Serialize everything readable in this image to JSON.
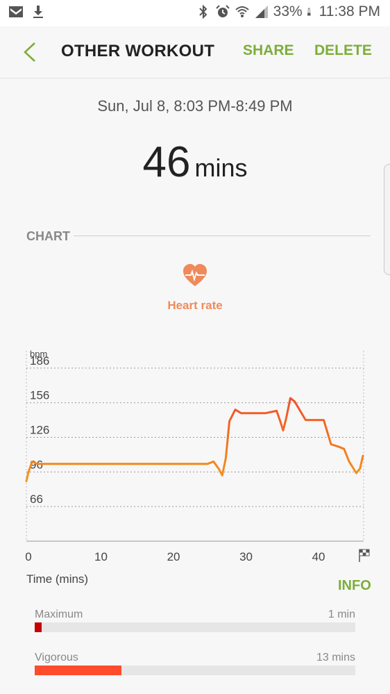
{
  "status_bar": {
    "battery": "33%",
    "time": "11:38 PM"
  },
  "header": {
    "title": "OTHER WORKOUT",
    "share_label": "SHARE",
    "delete_label": "DELETE"
  },
  "workout": {
    "date_range": "Sun, Jul 8, 8:03 PM-8:49 PM",
    "duration_value": "46",
    "duration_unit": "mins"
  },
  "section": {
    "label": "CHART",
    "metric_label": "Heart rate",
    "metric_color": "#f08a5a"
  },
  "chart_data": {
    "type": "line",
    "ylabel": "bpm",
    "xlabel": "Time (mins)",
    "y_ticks": [
      186,
      156,
      126,
      96,
      66
    ],
    "x_ticks": [
      0,
      10,
      20,
      30,
      40
    ],
    "xlim": [
      0,
      46.5
    ],
    "ylim": [
      36,
      201
    ],
    "grid": true,
    "line_color_low": "#f39a1b",
    "line_color_high": "#f0542a",
    "series": [
      {
        "values": [
          [
            0,
            88
          ],
          [
            0.3,
            96
          ],
          [
            0.8,
            105
          ],
          [
            1.5,
            103
          ],
          [
            2,
            103
          ],
          [
            5,
            103
          ],
          [
            10,
            103
          ],
          [
            15,
            103
          ],
          [
            20,
            103
          ],
          [
            24,
            103
          ],
          [
            25,
            103
          ],
          [
            25.8,
            105
          ],
          [
            26.6,
            98
          ],
          [
            27,
            93
          ],
          [
            27.5,
            108
          ],
          [
            28,
            140
          ],
          [
            28.8,
            150
          ],
          [
            29.6,
            147
          ],
          [
            31,
            147
          ],
          [
            33,
            147
          ],
          [
            34.5,
            149
          ],
          [
            35,
            140
          ],
          [
            35.4,
            132
          ],
          [
            35.8,
            142
          ],
          [
            36.4,
            160
          ],
          [
            37,
            157
          ],
          [
            38.5,
            141
          ],
          [
            40,
            141
          ],
          [
            41,
            141
          ],
          [
            42,
            120
          ],
          [
            43,
            118
          ],
          [
            43.8,
            116
          ],
          [
            44.5,
            105
          ],
          [
            45.5,
            95
          ],
          [
            46,
            99
          ],
          [
            46.4,
            110
          ]
        ]
      }
    ]
  },
  "zones": {
    "maximum": {
      "label": "Maximum",
      "value": "1 min",
      "fraction": 0.022,
      "color": "#c40000"
    },
    "vigorous": {
      "label": "Vigorous",
      "value": "13 mins",
      "fraction": 0.27,
      "color": "#ff4c2c"
    }
  },
  "info_label": "INFO",
  "accent_color": "#7cae3a"
}
